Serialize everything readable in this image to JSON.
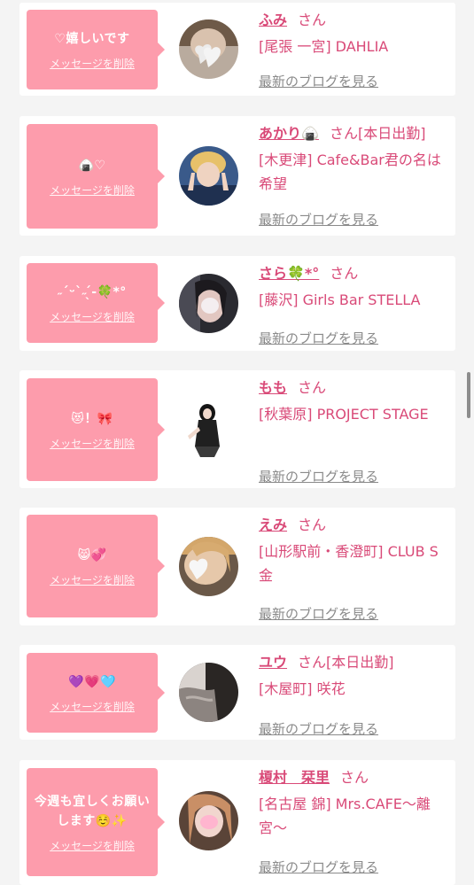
{
  "entries": [
    {
      "message": "♡嬉しいです",
      "delete_label": "メッセージを削除",
      "name": "ふみ",
      "san": "さん",
      "status": "",
      "shop": "[尾張 一宮] DAHLIA",
      "blog_link": "最新のブログを見る",
      "avatar_icon": "girl-avatar-heart-sticker"
    },
    {
      "message": "🍙♡",
      "delete_label": "メッセージを削除",
      "name": "あかり🍙",
      "san": "さん",
      "status": "[本日出勤]",
      "shop": "[木更津] Cafe&Bar君の名は希望",
      "blog_link": "最新のブログを見る",
      "avatar_icon": "girl-avatar-peace-sign"
    },
    {
      "message": "˶ˊᵕˋ˶ ̖́-🍀*°",
      "delete_label": "メッセージを削除",
      "name": "さら🍀*°",
      "san": "さん",
      "status": "",
      "shop": "[藤沢] Girls Bar STELLA",
      "blog_link": "最新のブログを見る",
      "avatar_icon": "girl-avatar-blurred-face"
    },
    {
      "message": "😻！🎀",
      "delete_label": "メッセージを削除",
      "name": "もも",
      "san": "さん",
      "status": "",
      "shop": "[秋葉原] PROJECT STAGE",
      "blog_link": "最新のブログを見る",
      "avatar_icon": "girl-avatar-full-body"
    },
    {
      "message": "😸💞",
      "delete_label": "メッセージを削除",
      "name": "えみ",
      "san": "さん",
      "status": "",
      "shop": "[山形駅前・香澄町] CLUB S金",
      "blog_link": "最新のブログを見る",
      "avatar_icon": "girl-avatar-heart-sticker"
    },
    {
      "message": "💜💗🩵",
      "delete_label": "メッセージを削除",
      "name": "ユウ",
      "san": "さん",
      "status": "[本日出勤]",
      "shop": "[木屋町] 咲花",
      "blog_link": "最新のブログを見る",
      "avatar_icon": "girl-avatar-dark"
    },
    {
      "message": "今週も宜しくお願いします☺️✨",
      "delete_label": "メッセージを削除",
      "name": "榎村　栞里",
      "san": "さん",
      "status": "",
      "shop": "[名古屋 錦] Mrs.CAFE〜離宮〜",
      "blog_link": "最新のブログを見る",
      "avatar_icon": "girl-avatar-blurred-face"
    }
  ],
  "colors": {
    "accent": "#d94a78",
    "bubble": "#fd9cac",
    "link_gray": "#8a8a8a",
    "background": "#f4f4f4"
  }
}
